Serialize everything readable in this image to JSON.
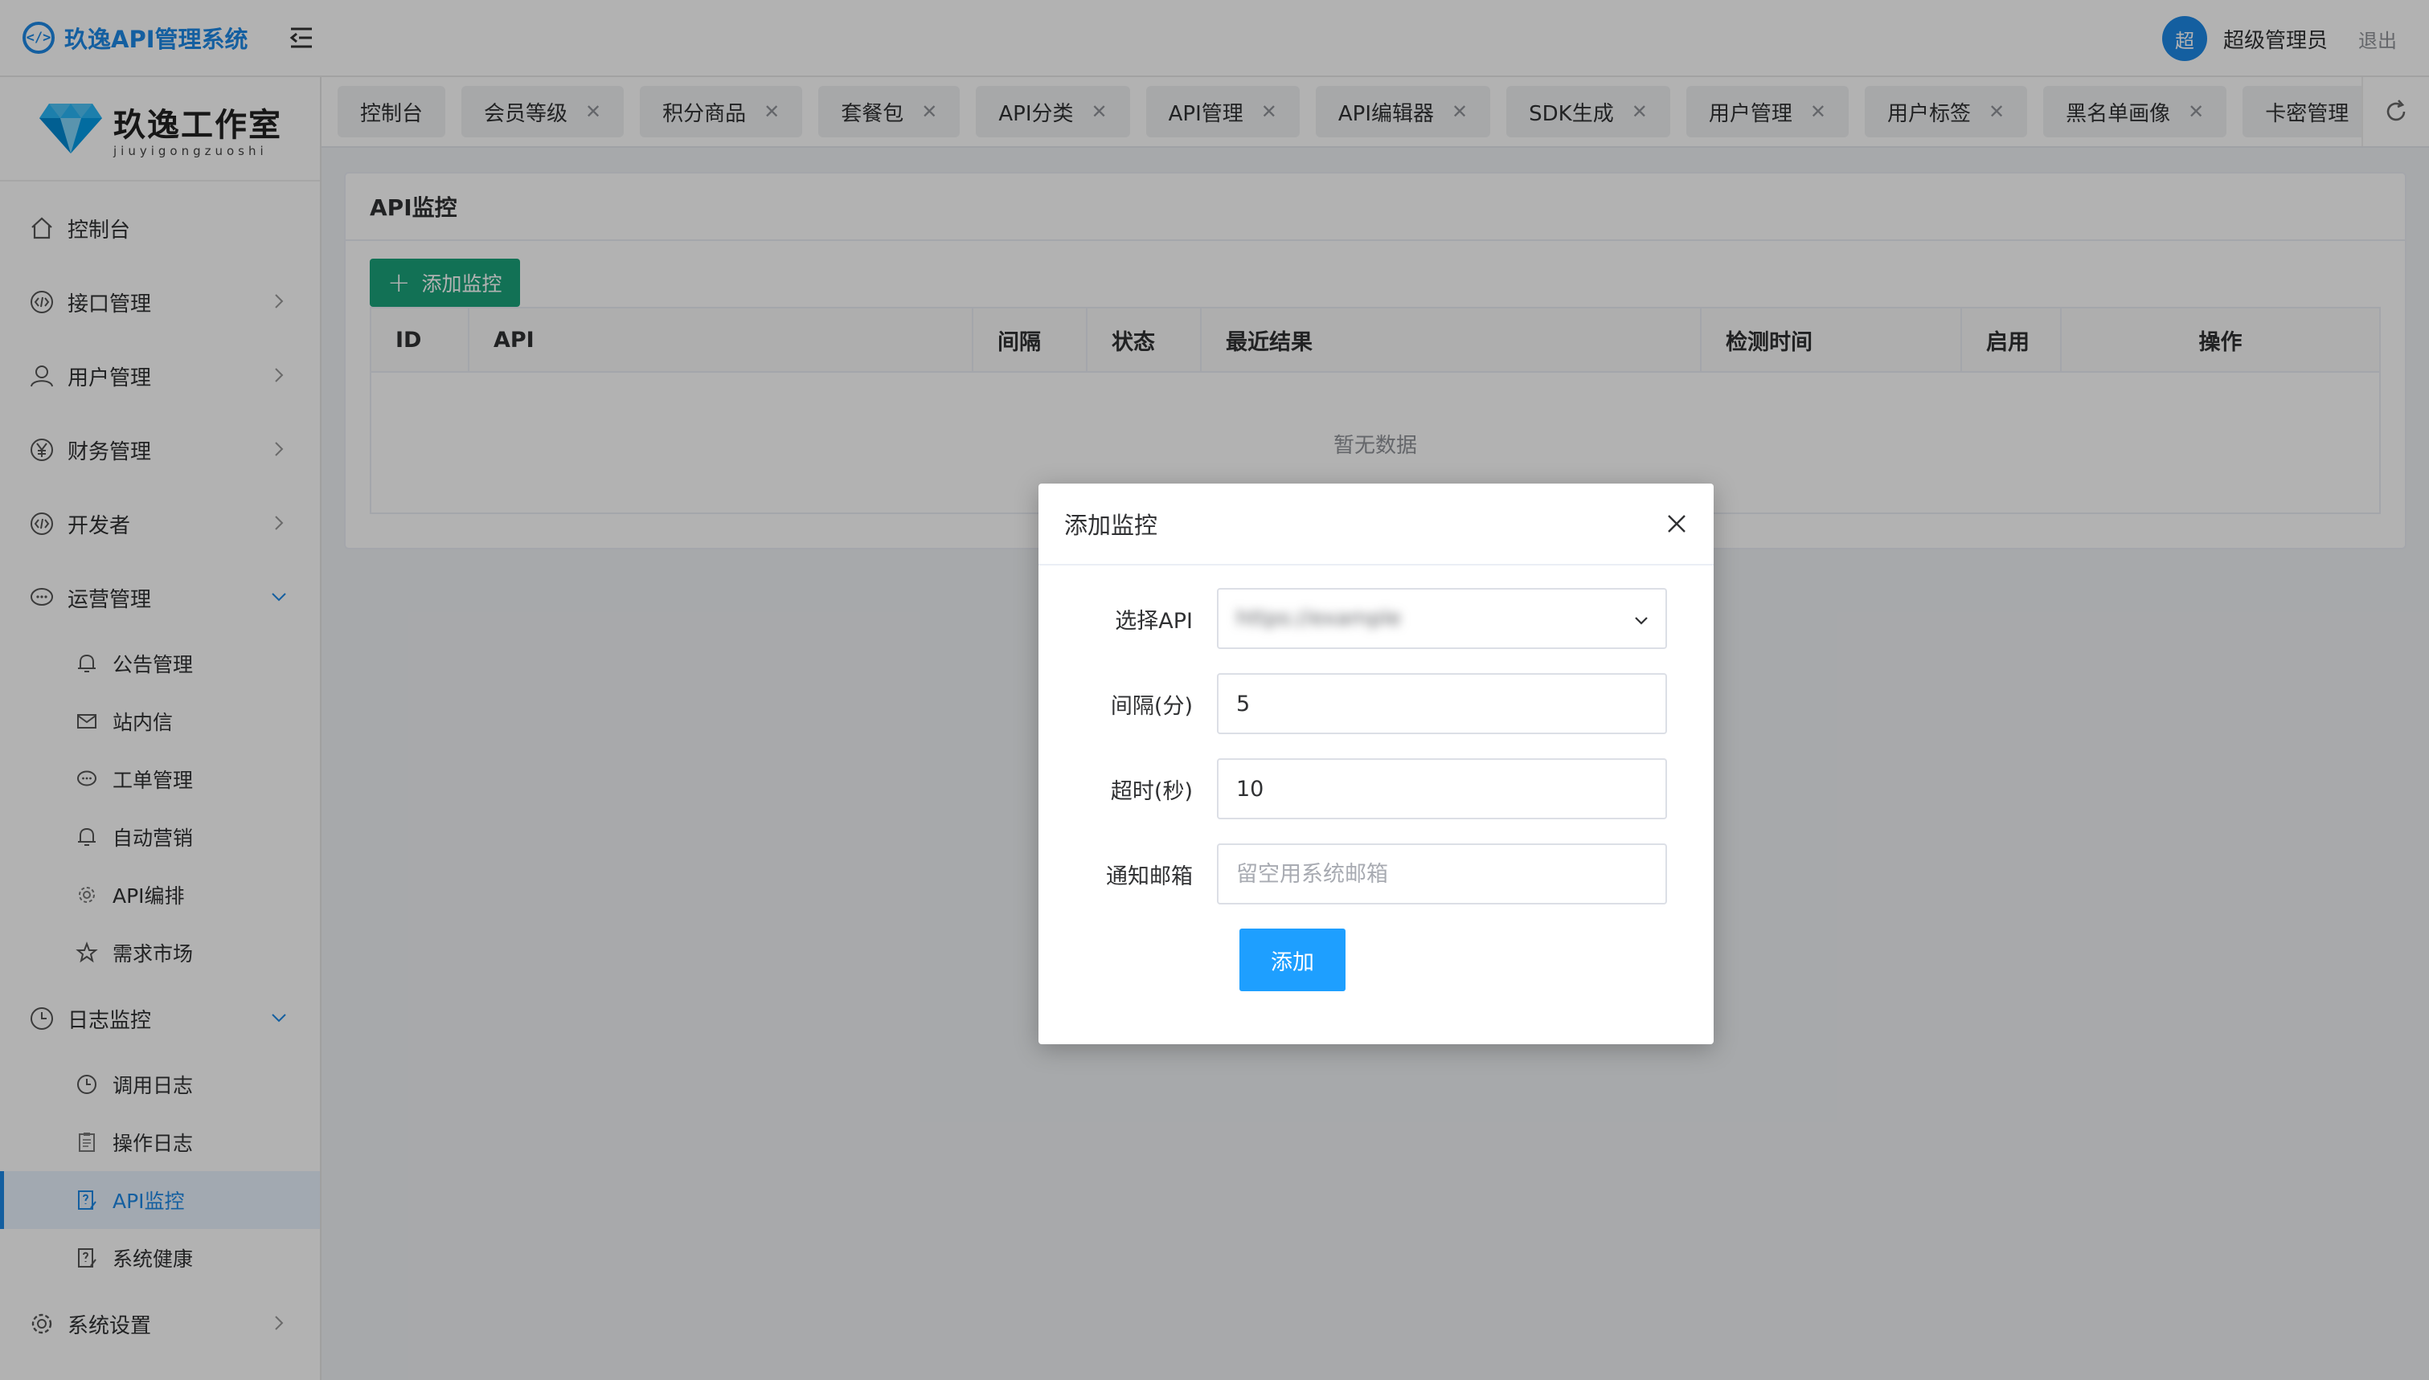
{
  "header": {
    "brand_icon": "</>",
    "app_title": "玖逸API管理系统",
    "user_avatar": "超",
    "user_name": "超级管理员",
    "logout_label": "退出"
  },
  "sidebar": {
    "logo_cn": "玖逸工作室",
    "logo_pinyin": "jiuyigongzuoshi",
    "items": [
      {
        "label": "控制台",
        "icon": "home-icon"
      },
      {
        "label": "接口管理",
        "icon": "code-icon"
      },
      {
        "label": "用户管理",
        "icon": "user-icon"
      },
      {
        "label": "财务管理",
        "icon": "yen-icon"
      },
      {
        "label": "开发者",
        "icon": "code-icon"
      },
      {
        "label": "运营管理",
        "icon": "chat-icon"
      },
      {
        "label": "日志监控",
        "icon": "clock-icon"
      },
      {
        "label": "系统设置",
        "icon": "gear-icon"
      }
    ],
    "ops_children": [
      "公告管理",
      "站内信",
      "工单管理",
      "自动营销",
      "API编排",
      "需求市场"
    ],
    "log_children": [
      "调用日志",
      "操作日志",
      "API监控",
      "系统健康"
    ]
  },
  "tabs": [
    "控制台",
    "会员等级",
    "积分商品",
    "套餐包",
    "API分类",
    "API管理",
    "API编辑器",
    "SDK生成",
    "用户管理",
    "用户标签",
    "黑名单画像",
    "卡密管理"
  ],
  "main": {
    "card_title": "API监控",
    "add_button_label": "添加监控",
    "table_headers": [
      "ID",
      "API",
      "间隔",
      "状态",
      "最近结果",
      "检测时间",
      "启用",
      "操作"
    ],
    "empty_text": "暂无数据"
  },
  "dialog": {
    "title": "添加监控",
    "api_label": "选择API",
    "api_value": "https://example",
    "interval_label": "间隔(分)",
    "interval_value": "5",
    "timeout_label": "超时(秒)",
    "timeout_value": "10",
    "email_label": "通知邮箱",
    "email_placeholder": "留空用系统邮箱",
    "submit_label": "添加"
  },
  "colors": {
    "primary": "#1e88e5",
    "add_green": "#1aa37a",
    "submit_blue": "#1e9fff"
  }
}
